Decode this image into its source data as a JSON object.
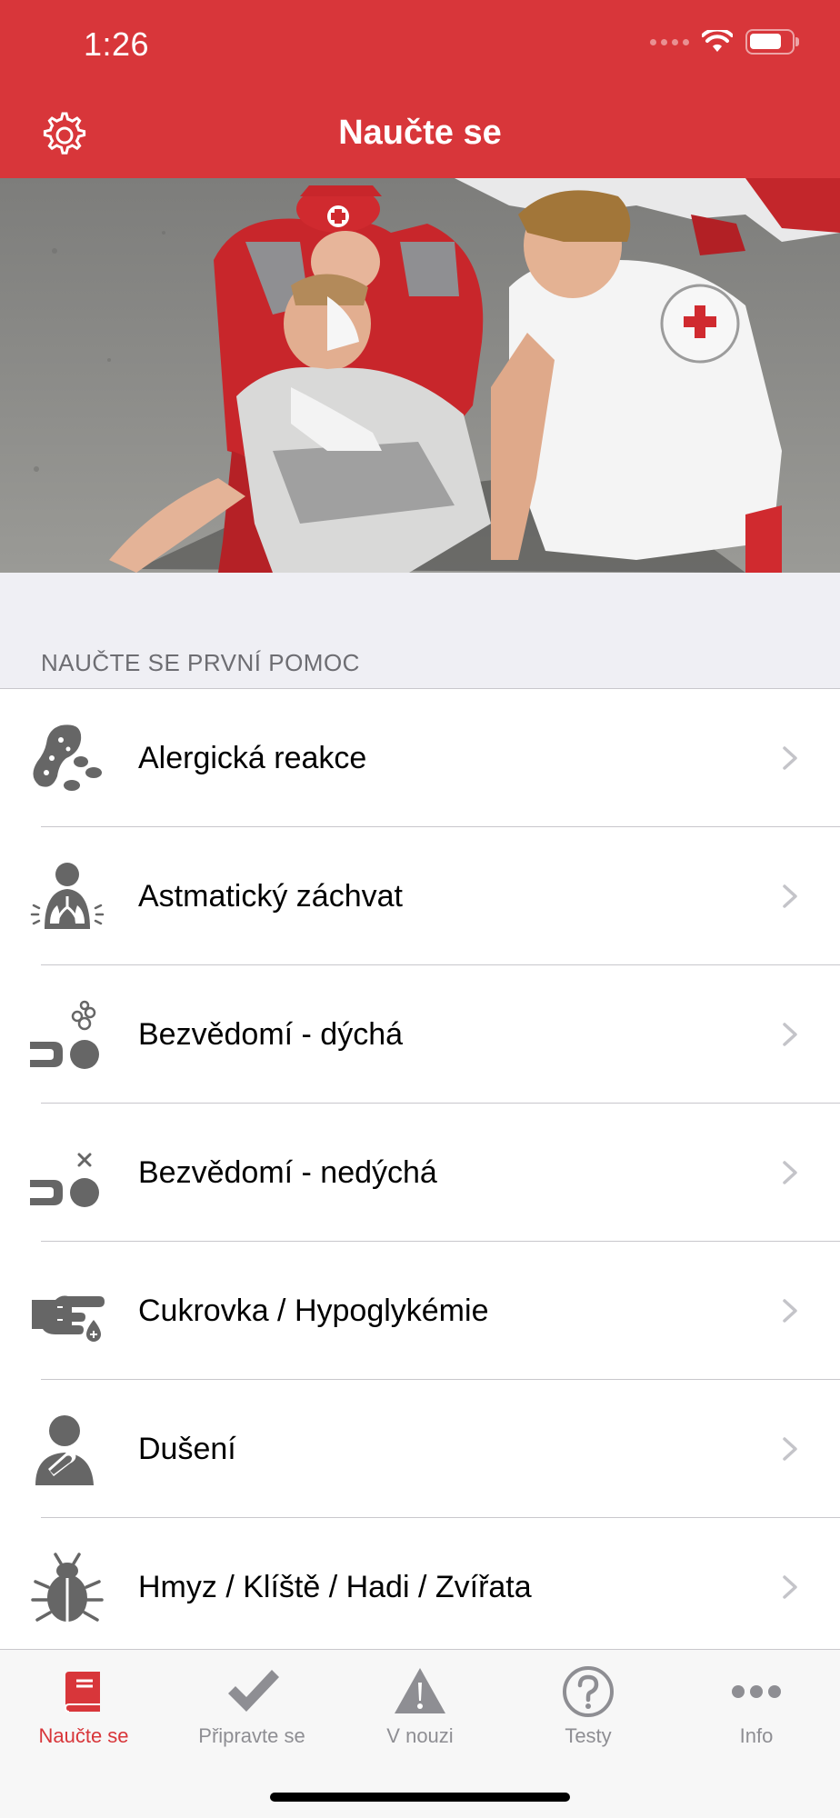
{
  "status": {
    "time": "1:26"
  },
  "nav": {
    "title": "Naučte se"
  },
  "section": {
    "title": "NAUČTE SE PRVNÍ POMOC"
  },
  "items": [
    {
      "label": "Alergická reakce",
      "icon": "peanut-icon"
    },
    {
      "label": "Astmatický záchvat",
      "icon": "lungs-icon"
    },
    {
      "label": "Bezvědomí - dýchá",
      "icon": "unconscious-breathing-icon"
    },
    {
      "label": "Bezvědomí - nedýchá",
      "icon": "unconscious-not-breathing-icon"
    },
    {
      "label": "Cukrovka / Hypoglykémie",
      "icon": "finger-blood-drop-icon"
    },
    {
      "label": "Dušení",
      "icon": "choking-icon"
    },
    {
      "label": "Hmyz / Klíště / Hadi / Zvířata",
      "icon": "bug-icon"
    }
  ],
  "tabs": [
    {
      "label": "Naučte se",
      "icon": "book-icon",
      "active": true
    },
    {
      "label": "Připravte se",
      "icon": "checkmark-icon",
      "active": false
    },
    {
      "label": "V nouzi",
      "icon": "warning-icon",
      "active": false
    },
    {
      "label": "Testy",
      "icon": "question-icon",
      "active": false
    },
    {
      "label": "Info",
      "icon": "more-icon",
      "active": false
    }
  ],
  "colors": {
    "brand": "#d8363a",
    "icon": "#666666",
    "inactive": "#8e8e93"
  }
}
